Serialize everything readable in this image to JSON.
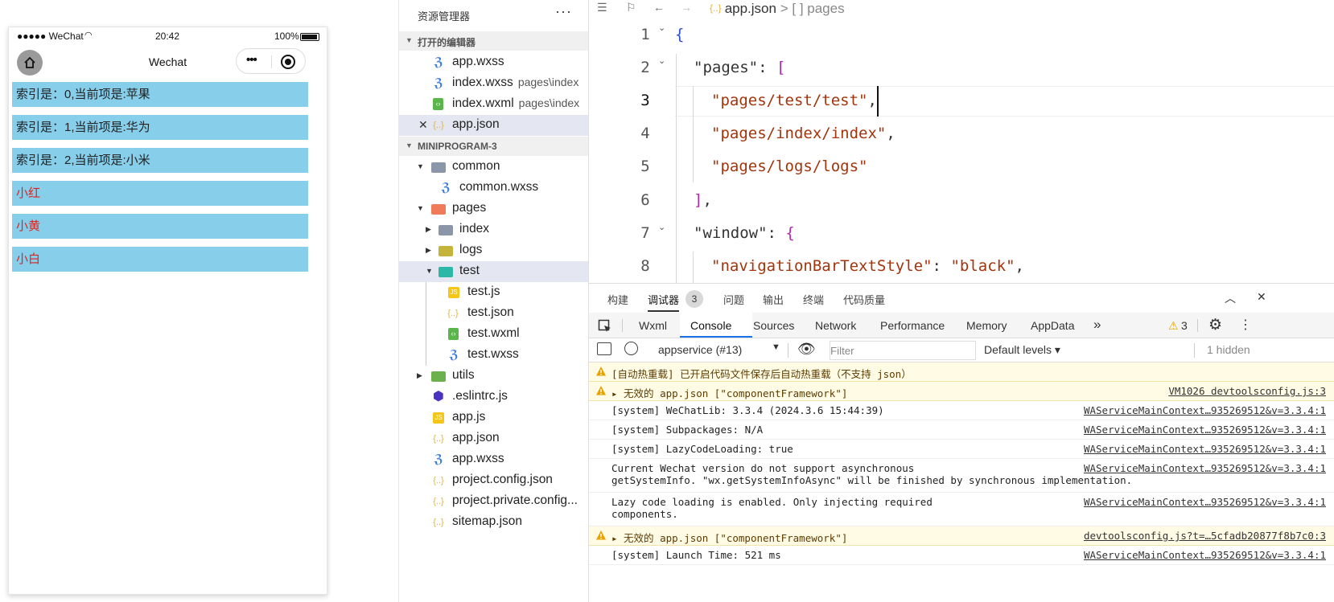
{
  "simulator": {
    "status": {
      "carrier": "●●●●● WeChat",
      "time": "20:42",
      "battery": "100%"
    },
    "nav_title": "Wechat",
    "items": [
      {
        "text": "索引是：0,当前项是:苹果",
        "color": "dark"
      },
      {
        "text": "索引是：1,当前项是:华为",
        "color": "dark"
      },
      {
        "text": "索引是：2,当前项是:小米",
        "color": "dark"
      },
      {
        "text": "小红",
        "color": "red"
      },
      {
        "text": "小黄",
        "color": "red"
      },
      {
        "text": "小白",
        "color": "red"
      }
    ],
    "item_bg": "#87ceeb",
    "item_red": "#e0231b"
  },
  "explorer": {
    "title": "资源管理器",
    "more": "···",
    "open_editors_label": "打开的编辑器",
    "project_label": "MINIPROGRAM-3",
    "open_editors": [
      {
        "name": "app.wxss",
        "hint": "",
        "icon": "css-icon"
      },
      {
        "name": "index.wxss",
        "hint": "pages\\index",
        "icon": "css-icon"
      },
      {
        "name": "index.wxml",
        "hint": "pages\\index",
        "icon": "wxml-icon"
      },
      {
        "name": "app.json",
        "hint": "",
        "icon": "json-icon"
      }
    ],
    "tree": [
      {
        "name": "common",
        "icon": "folder-icon"
      },
      {
        "name": "common.wxss",
        "icon": "css-icon"
      },
      {
        "name": "pages",
        "icon": "folder-icon"
      },
      {
        "name": "index",
        "icon": "folder-icon"
      },
      {
        "name": "logs",
        "icon": "folder-icon"
      },
      {
        "name": "test",
        "icon": "folder-icon"
      },
      {
        "name": "test.js",
        "icon": "js-icon"
      },
      {
        "name": "test.json",
        "icon": "json-icon"
      },
      {
        "name": "test.wxml",
        "icon": "wxml-icon"
      },
      {
        "name": "test.wxss",
        "icon": "css-icon"
      },
      {
        "name": "utils",
        "icon": "folder-icon"
      },
      {
        "name": ".eslintrc.js",
        "icon": "eslint-icon"
      },
      {
        "name": "app.js",
        "icon": "js-icon"
      },
      {
        "name": "app.json",
        "icon": "json-icon"
      },
      {
        "name": "app.wxss",
        "icon": "css-icon"
      },
      {
        "name": "project.config.json",
        "icon": "json-icon"
      },
      {
        "name": "project.private.config...",
        "icon": "json-icon"
      },
      {
        "name": "sitemap.json",
        "icon": "json-icon"
      }
    ]
  },
  "editor": {
    "breadcrumb": {
      "file": "app.json",
      "sep": ">",
      "symbol": "[ ] pages"
    },
    "line_numbers": [
      "1",
      "2",
      "3",
      "4",
      "5",
      "6",
      "7",
      "8"
    ],
    "lines": [
      {
        "parts": [
          [
            "b1",
            "{"
          ]
        ]
      },
      {
        "parts": [
          [
            "k",
            "\"pages\""
          ],
          [
            "p",
            ": "
          ],
          [
            "b2",
            "["
          ]
        ]
      },
      {
        "parts": [
          [
            "s",
            "\"pages/test/test\""
          ],
          [
            "p",
            ","
          ]
        ]
      },
      {
        "parts": [
          [
            "s",
            "\"pages/index/index\""
          ],
          [
            "p",
            ","
          ]
        ]
      },
      {
        "parts": [
          [
            "s",
            "\"pages/logs/logs\""
          ]
        ]
      },
      {
        "parts": [
          [
            "b2",
            "]"
          ],
          [
            "p",
            ","
          ]
        ]
      },
      {
        "parts": [
          [
            "k",
            "\"window\""
          ],
          [
            "p",
            ": "
          ],
          [
            "b2",
            "{"
          ]
        ]
      },
      {
        "parts": [
          [
            "s",
            "\"navigationBarTextStyle\""
          ],
          [
            "p",
            ": "
          ],
          [
            "s",
            "\"black\""
          ],
          [
            "p",
            ","
          ]
        ]
      }
    ]
  },
  "panel": {
    "top_tabs": [
      "构建",
      "调试器",
      "问题",
      "输出",
      "终端",
      "代码质量"
    ],
    "debugger_badge": "3",
    "devtools_tabs": [
      "Wxml",
      "Console",
      "Sources",
      "Network",
      "Performance",
      "Memory",
      "AppData"
    ],
    "more_tabs": "»",
    "warning_count": "3",
    "context": "appservice (#13)",
    "filter_placeholder": "Filter",
    "levels": "Default levels ▾",
    "hidden": "1 hidden",
    "logs": [
      {
        "type": "warn",
        "msg": "[自动热重载] 已开启代码文件保存后自动热重载（不支持 json）",
        "src": "",
        "lines": 1
      },
      {
        "type": "warn",
        "msg": "▸ 无效的 app.json [\"componentFramework\"]",
        "src": "VM1026 devtoolsconfig.js:3",
        "lines": 1
      },
      {
        "type": "info",
        "msg": "[system] WeChatLib: 3.3.4 (2024.3.6 15:44:39)",
        "src": "WAServiceMainContext…935269512&v=3.3.4:1",
        "lines": 1
      },
      {
        "type": "info",
        "msg": "[system] Subpackages: N/A",
        "src": "WAServiceMainContext…935269512&v=3.3.4:1",
        "lines": 1
      },
      {
        "type": "info",
        "msg": "[system] LazyCodeLoading: true",
        "src": "WAServiceMainContext…935269512&v=3.3.4:1",
        "lines": 1
      },
      {
        "type": "info",
        "msg": "Current Wechat version do not support asynchronous\ngetSystemInfo. \"wx.getSystemInfoAsync\" will be finished by synchronous implementation.",
        "src": "WAServiceMainContext…935269512&v=3.3.4:1",
        "lines": 2
      },
      {
        "type": "info",
        "msg": "Lazy code loading is enabled. Only injecting required\ncomponents.",
        "src": "WAServiceMainContext…935269512&v=3.3.4:1",
        "lines": 2
      },
      {
        "type": "warn",
        "msg": "▸ 无效的 app.json [\"componentFramework\"]",
        "src": "devtoolsconfig.js?t=…5cfadb20877f8b7c0:3",
        "lines": 1
      },
      {
        "type": "info",
        "msg": "[system] Launch Time: 521 ms",
        "src": "WAServiceMainContext…935269512&v=3.3.4:1",
        "lines": 1
      }
    ]
  }
}
